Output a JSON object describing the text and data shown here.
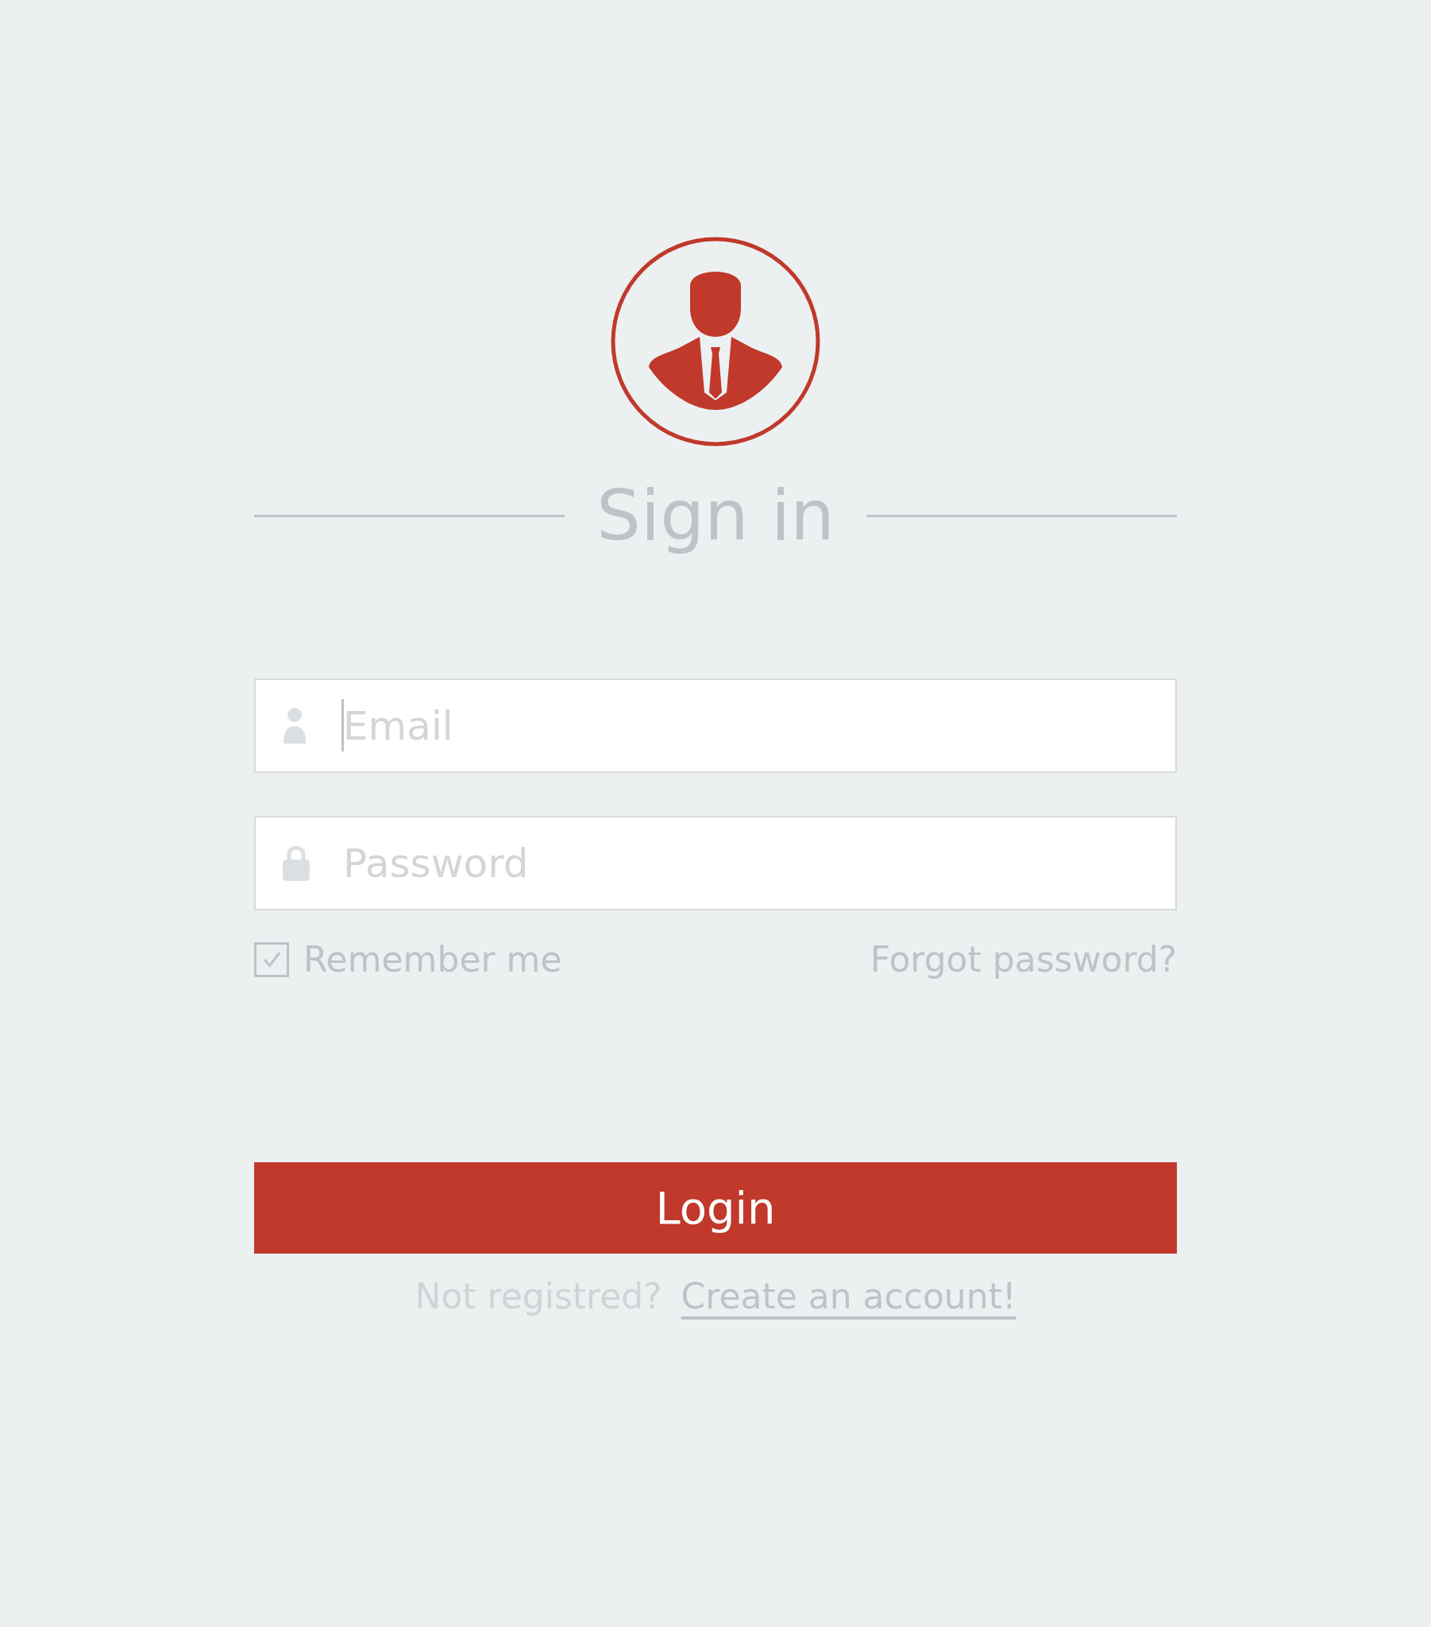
{
  "heading": "Sign in",
  "fields": [
    {
      "kind": "user",
      "placeholder": "Email",
      "focused": true
    },
    {
      "kind": "lock",
      "placeholder": "Password",
      "focused": false
    }
  ],
  "remember": {
    "label": "Remember me",
    "checked": true
  },
  "forgot_link": "Forgot password?",
  "login_button": "Login",
  "register": {
    "text": "Not registred?",
    "link": "Create an account!"
  }
}
